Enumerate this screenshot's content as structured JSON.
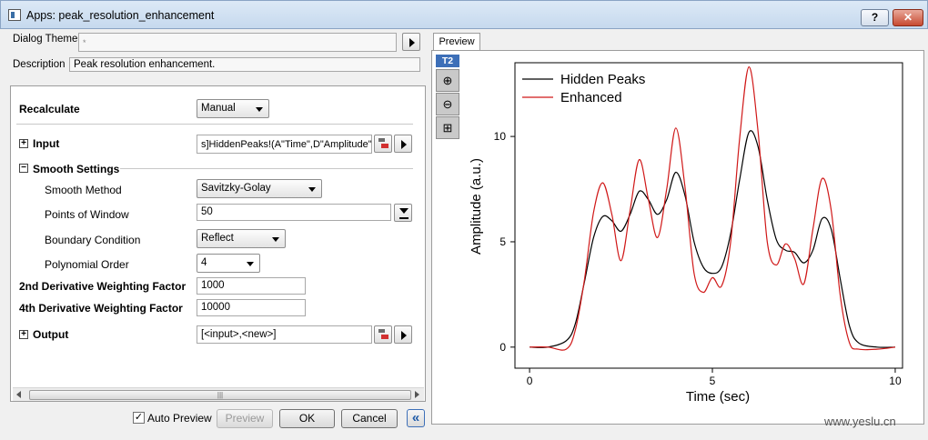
{
  "window": {
    "title": "Apps: peak_resolution_enhancement",
    "help_label": "?",
    "close_label": "✕"
  },
  "dialog_theme": {
    "label": "Dialog Theme",
    "value": "*"
  },
  "description": {
    "label": "Description",
    "value": "Peak resolution enhancement."
  },
  "settings": {
    "recalculate": {
      "label": "Recalculate",
      "value": "Manual"
    },
    "input": {
      "label": "Input",
      "value": "s]HiddenPeaks!(A\"Time\",D\"Amplitude\")"
    },
    "smooth": {
      "label": "Smooth Settings",
      "method": {
        "label": "Smooth Method",
        "value": "Savitzky-Golay"
      },
      "points": {
        "label": "Points of Window",
        "value": "50"
      },
      "boundary": {
        "label": "Boundary Condition",
        "value": "Reflect"
      },
      "order": {
        "label": "Polynomial Order",
        "value": "4"
      }
    },
    "second_deriv": {
      "label": "2nd Derivative Weighting Factor",
      "value": "1000"
    },
    "fourth_deriv": {
      "label": "4th Derivative Weighting Factor",
      "value": "10000"
    },
    "output": {
      "label": "Output",
      "value": "[<input>,<new>]"
    },
    "expander_plus": "+",
    "expander_minus": "−"
  },
  "footer": {
    "auto_preview_label": "Auto Preview",
    "auto_preview_checked": "✓",
    "preview_label": "Preview",
    "ok_label": "OK",
    "cancel_label": "Cancel",
    "collapse_label": "«"
  },
  "preview_tab": {
    "label": "Preview",
    "badge": "T2",
    "tools": [
      {
        "name": "zoom-in-icon",
        "glyph": "⊕"
      },
      {
        "name": "zoom-out-icon",
        "glyph": "⊖"
      },
      {
        "name": "rescale-icon",
        "glyph": "⊞"
      }
    ]
  },
  "colors": {
    "hidden_peaks": "#000000",
    "enhanced": "#d01818",
    "accent": "#3d6fb8"
  },
  "watermark": "www.yeslu.cn",
  "chart_data": {
    "type": "line",
    "xlabel": "Time (sec)",
    "ylabel": "Amplitude (a.u.)",
    "xlim": [
      -0.4,
      10.2
    ],
    "ylim": [
      -1,
      13.5
    ],
    "xticks": [
      0,
      5,
      10
    ],
    "yticks": [
      0,
      5,
      10
    ],
    "grid": false,
    "legend_position": "top-left",
    "series": [
      {
        "name": "Hidden Peaks",
        "color": "#000000",
        "x": [
          0,
          0.5,
          1,
          1.25,
          1.5,
          1.75,
          2,
          2.25,
          2.5,
          2.75,
          3,
          3.25,
          3.5,
          3.75,
          4,
          4.25,
          4.5,
          4.75,
          5,
          5.25,
          5.5,
          5.75,
          6,
          6.25,
          6.5,
          6.75,
          7,
          7.25,
          7.5,
          7.75,
          8,
          8.25,
          8.5,
          8.75,
          9,
          9.5,
          10
        ],
        "y": [
          0,
          0,
          0.3,
          1.1,
          3.1,
          5.2,
          6.2,
          6.0,
          5.5,
          6.3,
          7.4,
          7.0,
          6.3,
          7.0,
          8.3,
          7.2,
          5.0,
          3.8,
          3.5,
          3.8,
          5.4,
          8.0,
          10.2,
          9.5,
          7.0,
          5.1,
          4.6,
          4.5,
          4.0,
          4.6,
          6.1,
          5.6,
          3.2,
          1.0,
          0.2,
          0,
          0
        ]
      },
      {
        "name": "Enhanced",
        "color": "#d01818",
        "x": [
          0,
          0.5,
          1,
          1.25,
          1.5,
          1.75,
          2,
          2.25,
          2.5,
          2.75,
          3,
          3.25,
          3.5,
          3.75,
          4,
          4.25,
          4.5,
          4.75,
          5,
          5.25,
          5.5,
          5.75,
          6,
          6.25,
          6.5,
          6.75,
          7,
          7.25,
          7.5,
          7.75,
          8,
          8.25,
          8.5,
          8.75,
          9,
          9.5,
          10
        ],
        "y": [
          0,
          0,
          -0.1,
          0.8,
          3.2,
          6.4,
          7.8,
          6.3,
          4.1,
          6.5,
          8.9,
          7.0,
          5.2,
          7.5,
          10.4,
          7.6,
          3.5,
          2.6,
          3.3,
          2.9,
          5.0,
          10.0,
          13.3,
          10.2,
          5.0,
          3.9,
          4.9,
          4.2,
          3.0,
          5.6,
          8.0,
          6.5,
          2.4,
          0.2,
          -0.1,
          -0.1,
          0
        ]
      }
    ]
  }
}
